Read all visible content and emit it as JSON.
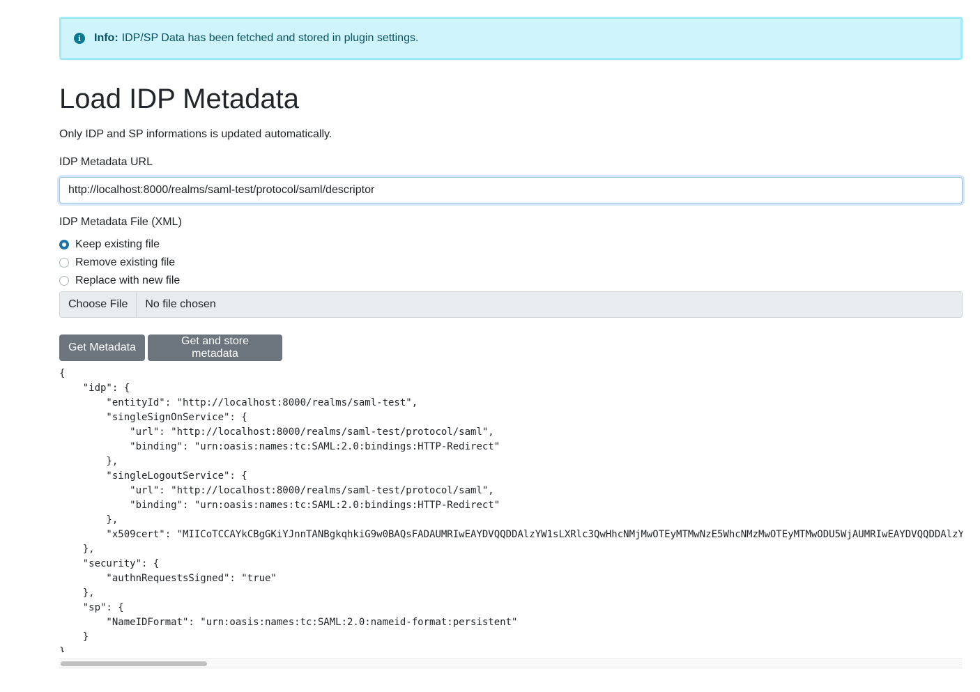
{
  "alert": {
    "label": "Info:",
    "message": "IDP/SP Data has been fetched and stored in plugin settings."
  },
  "page": {
    "title": "Load IDP Metadata",
    "subtitle": "Only IDP and SP informations is updated automatically."
  },
  "url_field": {
    "label": "IDP Metadata URL",
    "value": "http://localhost:8000/realms/saml-test/protocol/saml/descriptor"
  },
  "file_field": {
    "label": "IDP Metadata File (XML)",
    "options": [
      {
        "label": "Keep existing file",
        "checked": true
      },
      {
        "label": "Remove existing file",
        "checked": false
      },
      {
        "label": "Replace with new file",
        "checked": false
      }
    ],
    "choose_label": "Choose File",
    "status": "No file chosen"
  },
  "buttons": {
    "get_metadata": "Get Metadata",
    "get_and_store": "Get and store metadata"
  },
  "metadata_output": "{\n    \"idp\": {\n        \"entityId\": \"http://localhost:8000/realms/saml-test\",\n        \"singleSignOnService\": {\n            \"url\": \"http://localhost:8000/realms/saml-test/protocol/saml\",\n            \"binding\": \"urn:oasis:names:tc:SAML:2.0:bindings:HTTP-Redirect\"\n        },\n        \"singleLogoutService\": {\n            \"url\": \"http://localhost:8000/realms/saml-test/protocol/saml\",\n            \"binding\": \"urn:oasis:names:tc:SAML:2.0:bindings:HTTP-Redirect\"\n        },\n        \"x509cert\": \"MIICoTCCAYkCBgGKiYJnnTANBgkqhkiG9w0BAQsFADAUMRIwEAYDVQQDDAlzYW1sLXRlc3QwHhcNMjMwOTEyMTMwNzE5WhcNMzMwOTEyMTMwODU5WjAUMRIwEAYDVQQDDAlzY\n    },\n    \"security\": {\n        \"authnRequestsSigned\": \"true\"\n    },\n    \"sp\": {\n        \"NameIDFormat\": \"urn:oasis:names:tc:SAML:2.0:nameid-format:persistent\"\n    }\n}"
}
